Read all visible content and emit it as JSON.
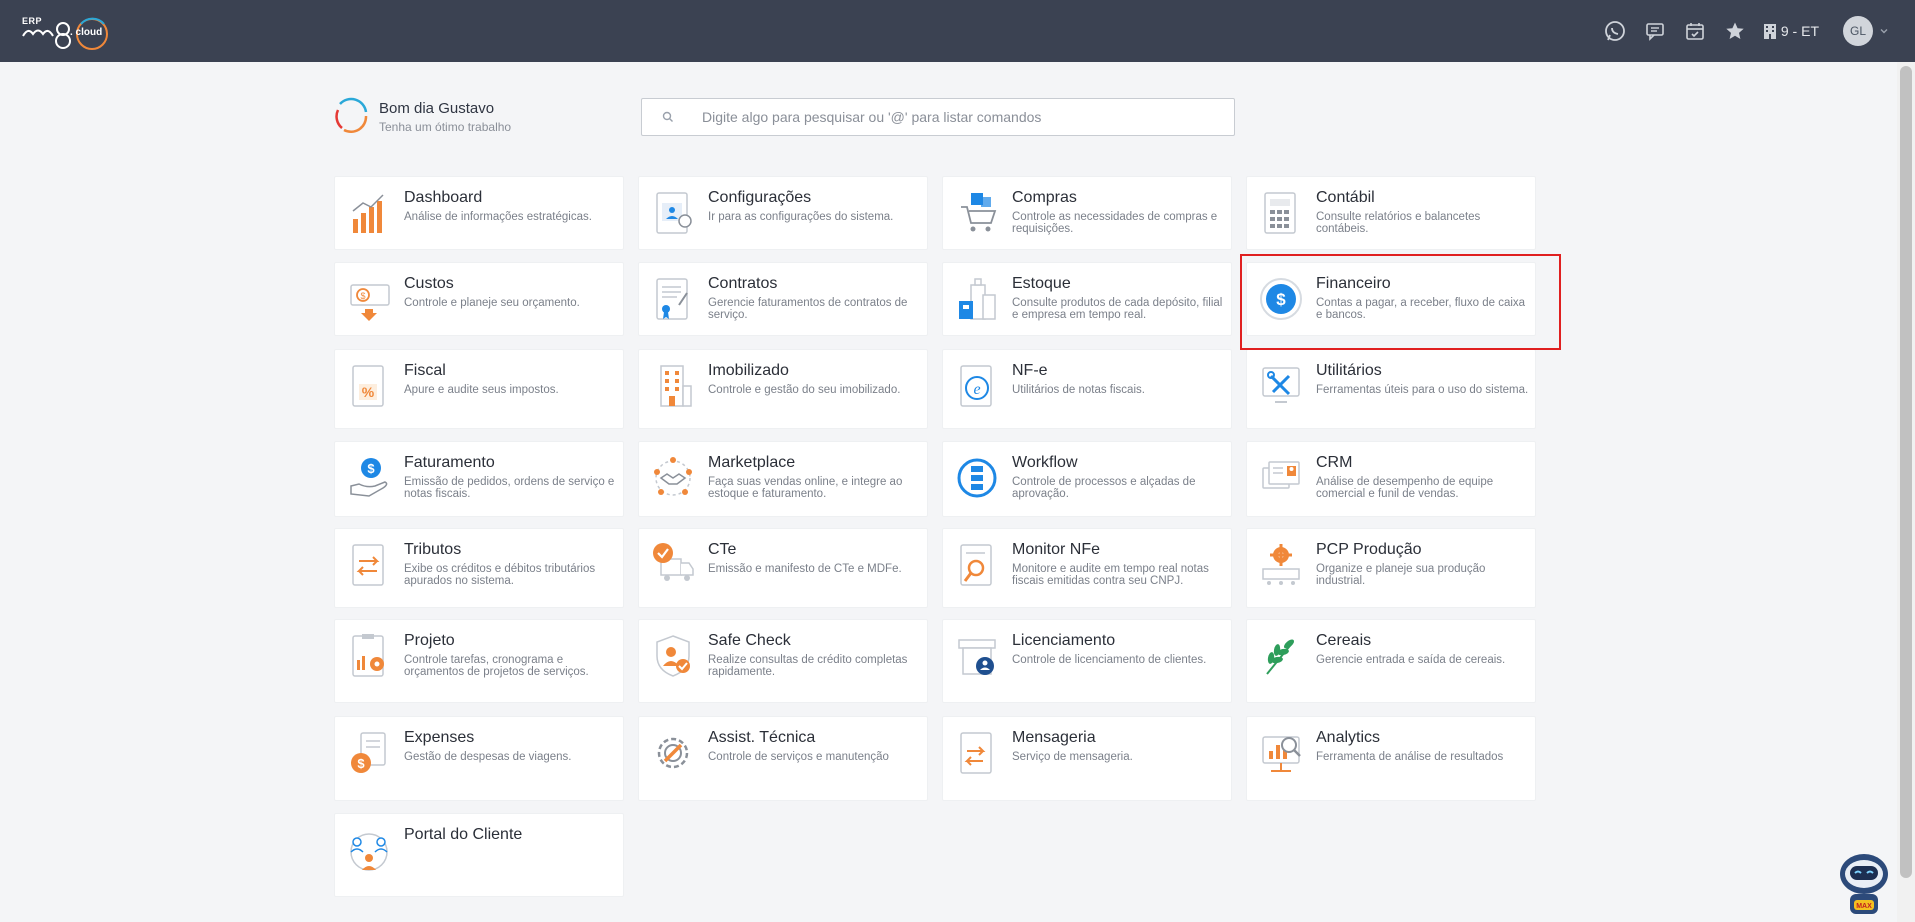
{
  "app": {
    "logo_prefix": "ERP",
    "logo_text": "m8",
    "logo_suffix": ". cloud"
  },
  "topbar": {
    "icons": [
      "whatsapp-icon",
      "message-icon",
      "calendar-icon",
      "star-icon"
    ],
    "company": "9 - ET",
    "user_initials": "GL"
  },
  "greeting": {
    "title": "Bom dia Gustavo",
    "subtitle": "Tenha um ótimo trabalho"
  },
  "search": {
    "placeholder": "Digite algo para pesquisar ou '@' para listar comandos",
    "value": ""
  },
  "modules": [
    {
      "title": "Dashboard",
      "desc": "Análise de informações estratégicas.",
      "icon": "chart-bar-icon"
    },
    {
      "title": "Configurações",
      "desc": "Ir para as configurações do sistema.",
      "icon": "settings-profile-icon"
    },
    {
      "title": "Compras",
      "desc": "Controle as necessidades de compras e requisições.",
      "icon": "shopping-cart-icon"
    },
    {
      "title": "Contábil",
      "desc": "Consulte relatórios e balancetes contábeis.",
      "icon": "calculator-icon"
    },
    {
      "title": "Custos",
      "desc": "Controle e planeje seu orçamento.",
      "icon": "cost-money-icon"
    },
    {
      "title": "Contratos",
      "desc": "Gerencie faturamentos de contratos de serviço.",
      "icon": "contract-icon"
    },
    {
      "title": "Estoque",
      "desc": "Consulte produtos de cada depósito, filial e empresa em tempo real.",
      "icon": "warehouse-icon"
    },
    {
      "title": "Financeiro",
      "desc": "Contas a pagar, a receber, fluxo de caixa e bancos.",
      "icon": "dollar-coin-icon"
    },
    {
      "title": "Fiscal",
      "desc": "Apure e audite seus impostos.",
      "icon": "percent-document-icon"
    },
    {
      "title": "Imobilizado",
      "desc": "Controle e gestão do seu imobilizado.",
      "icon": "building-icon"
    },
    {
      "title": "NF-e",
      "desc": "Utilitários de notas fiscais.",
      "icon": "nfe-document-icon"
    },
    {
      "title": "Utilitários",
      "desc": "Ferramentas úteis para o uso do sistema.",
      "icon": "tools-icon"
    },
    {
      "title": "Faturamento",
      "desc": "Emissão de pedidos, ordens de serviço e notas fiscais.",
      "icon": "billing-hand-icon"
    },
    {
      "title": "Marketplace",
      "desc": "Faça suas vendas online, e integre ao estoque e faturamento.",
      "icon": "marketplace-handshake-icon"
    },
    {
      "title": "Workflow",
      "desc": "Controle de processos e alçadas de aprovação.",
      "icon": "workflow-icon"
    },
    {
      "title": "CRM",
      "desc": "Análise de desempenho de equipe comercial e funil de vendas.",
      "icon": "crm-cards-icon"
    },
    {
      "title": "Tributos",
      "desc": "Exibe os créditos e débitos tributários apurados no sistema.",
      "icon": "tax-arrows-icon"
    },
    {
      "title": "CTe",
      "desc": "Emissão e manifesto de CTe e MDFe.",
      "icon": "truck-check-icon"
    },
    {
      "title": "Monitor NFe",
      "desc": "Monitore e audite em tempo real notas fiscais emitidas contra seu CNPJ.",
      "icon": "magnifier-document-icon"
    },
    {
      "title": "PCP Produção",
      "desc": "Organize e planeje sua produção industrial.",
      "icon": "production-gear-icon"
    },
    {
      "title": "Projeto",
      "desc": "Controle tarefas, cronograma e orçamentos de projetos de serviços.",
      "icon": "clipboard-gear-icon"
    },
    {
      "title": "Safe Check",
      "desc": "Realize consultas de crédito completas rapidamente.",
      "icon": "shield-check-icon"
    },
    {
      "title": "Licenciamento",
      "desc": "Controle de licenciamento de clientes.",
      "icon": "license-store-icon"
    },
    {
      "title": "Cereais",
      "desc": "Gerencie entrada e saída de cereais.",
      "icon": "leaf-icon"
    },
    {
      "title": "Expenses",
      "desc": "Gestão de despesas de viagens.",
      "icon": "expenses-icon"
    },
    {
      "title": "Assist. Técnica",
      "desc": "Controle de serviços e manutenção",
      "icon": "wrench-gear-icon"
    },
    {
      "title": "Mensageria",
      "desc": "Serviço de mensageria.",
      "icon": "message-document-icon"
    },
    {
      "title": "Analytics",
      "desc": "Ferramenta de análise de resultados",
      "icon": "analytics-monitor-icon"
    },
    {
      "title": "Portal do Cliente",
      "desc": "",
      "icon": "client-portal-icon"
    }
  ],
  "assistant": {
    "label": "MAX"
  },
  "colors": {
    "topbar": "#3b4252",
    "accent_orange": "#f0883a",
    "accent_blue": "#1e88e5",
    "highlight": "#e02020"
  }
}
